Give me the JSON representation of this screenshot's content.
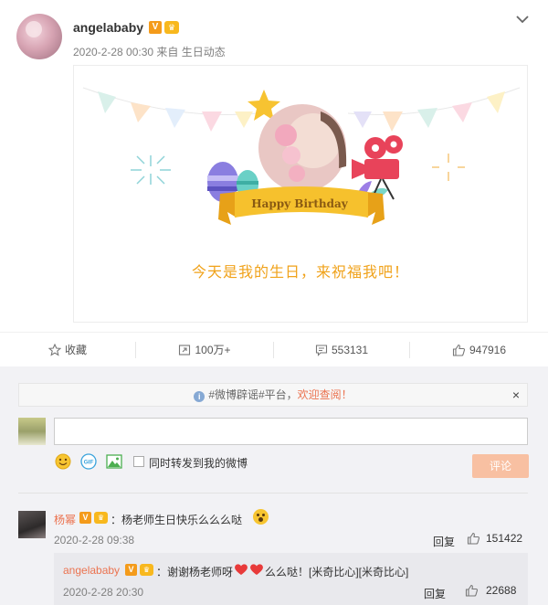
{
  "post": {
    "author": "angelababy",
    "verified_badge": "V",
    "timestamp": "2020-2-28 00:30",
    "source_prefix": "来自",
    "source": "生日动态"
  },
  "card": {
    "birthday_text": "Happy Birthday",
    "message": "今天是我的生日，来祝福我吧！"
  },
  "actions": {
    "favorite_label": "收藏",
    "repost_label": "100万+",
    "comment_count": "553131",
    "like_count": "947916"
  },
  "comments_section": {
    "notice_prefix": "#微博辟谣#平台，",
    "notice_link": "欢迎查阅！",
    "notice_close": "×",
    "forward_label": "同时转发到我的微博",
    "submit_label": "评论",
    "comment": {
      "author": "杨幂",
      "text": "：杨老师生日快乐么么么哒",
      "time": "2020-2-28 09:38",
      "reply_label": "回复",
      "like_count": "151422",
      "reply": {
        "author": "angelababy",
        "text_before": "：谢谢杨老师呀",
        "text_after": "么么哒！[米奇比心][米奇比心]",
        "time": "2020-2-28 20:30",
        "reply_label": "回复",
        "like_count": "22688"
      }
    }
  },
  "colors": {
    "accent_orange": "#eb7350",
    "badge_orange": "#f49b1b",
    "message_gold": "#f0a21a",
    "submit_disabled": "#f8c0a2"
  },
  "icons": [
    "chevron-down-icon",
    "star-icon",
    "repost-icon",
    "comment-icon",
    "thumbs-up-icon",
    "info-icon",
    "emoji-icon",
    "gif-icon",
    "image-icon",
    "heart-icon"
  ]
}
